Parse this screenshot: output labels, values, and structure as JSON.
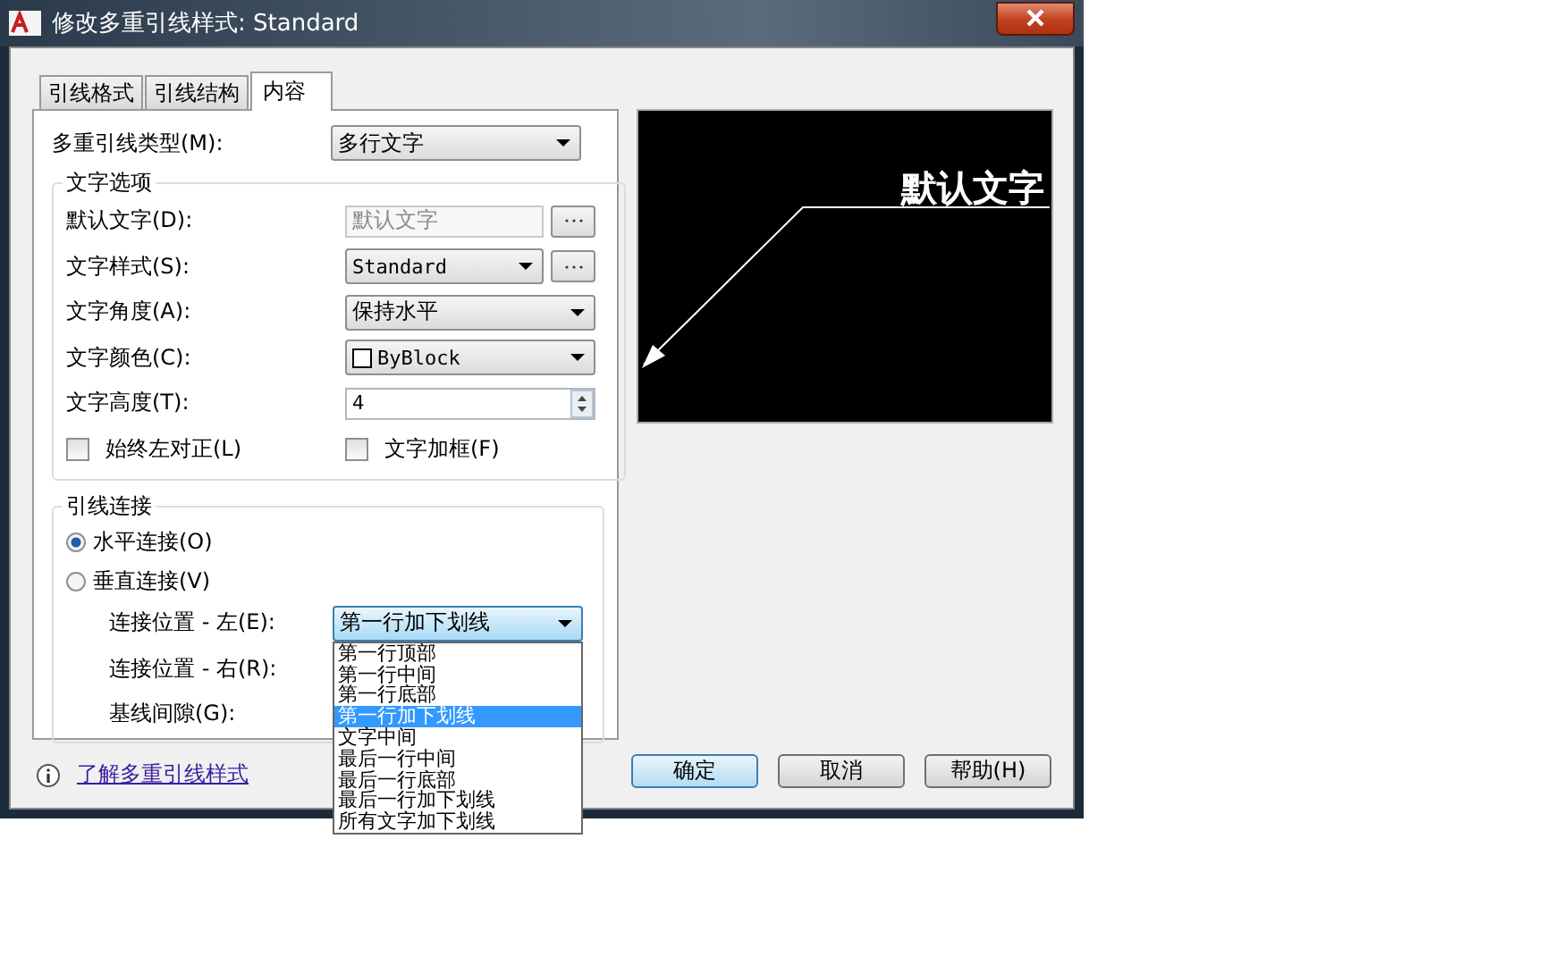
{
  "window": {
    "title": "修改多重引线样式: Standard"
  },
  "tabs": [
    {
      "label": "引线格式",
      "selected": false
    },
    {
      "label": "引线结构",
      "selected": false
    },
    {
      "label": "内容",
      "selected": true
    }
  ],
  "leader_type": {
    "label": "多重引线类型(M):",
    "value": "多行文字"
  },
  "text_options": {
    "title": "文字选项",
    "rows": [
      {
        "kind": "text-browse",
        "label": "默认文字(D):",
        "value": "默认文字",
        "disabled": true
      },
      {
        "kind": "combo-browse",
        "label": "文字样式(S):",
        "value": "Standard",
        "disabled": false
      },
      {
        "kind": "combo",
        "label": "文字角度(A):",
        "value": "保持水平",
        "disabled": false
      },
      {
        "kind": "color-combo",
        "label": "文字颜色(C):",
        "value": "ByBlock",
        "disabled": false
      },
      {
        "kind": "spinner",
        "label": "文字高度(T):",
        "value": "4",
        "disabled": false
      }
    ],
    "checkboxes": [
      {
        "label": "始终左对正(L)",
        "checked": false
      },
      {
        "label": "文字加框(F)",
        "checked": false
      }
    ]
  },
  "leader_connection": {
    "title": "引线连接",
    "radios": [
      {
        "label": "水平连接(O)",
        "selected": true
      },
      {
        "label": "垂直连接(V)",
        "selected": false
      }
    ],
    "rows": [
      {
        "kind": "combo",
        "label": "连接位置 - 左(E):",
        "value": "第一行加下划线",
        "expanded": true
      },
      {
        "kind": "label",
        "label": "连接位置 - 右(R):"
      },
      {
        "kind": "label",
        "label": "基线间隙(G):"
      }
    ]
  },
  "dropdown_list": [
    {
      "label": "第一行顶部",
      "selected": false
    },
    {
      "label": "第一行中间",
      "selected": false
    },
    {
      "label": "第一行底部",
      "selected": false
    },
    {
      "label": "第一行加下划线",
      "selected": true
    },
    {
      "label": "文字中间",
      "selected": false
    },
    {
      "label": "最后一行中间",
      "selected": false
    },
    {
      "label": "最后一行底部",
      "selected": false
    },
    {
      "label": "最后一行加下划线",
      "selected": false
    },
    {
      "label": "所有文字加下划线",
      "selected": false
    }
  ],
  "preview": {
    "text": "默认文字"
  },
  "help_link": "了解多重引线样式",
  "buttons": [
    {
      "label": "确定",
      "default": true
    },
    {
      "label": "取消",
      "default": false
    },
    {
      "label": "帮助(H)",
      "default": false
    }
  ]
}
